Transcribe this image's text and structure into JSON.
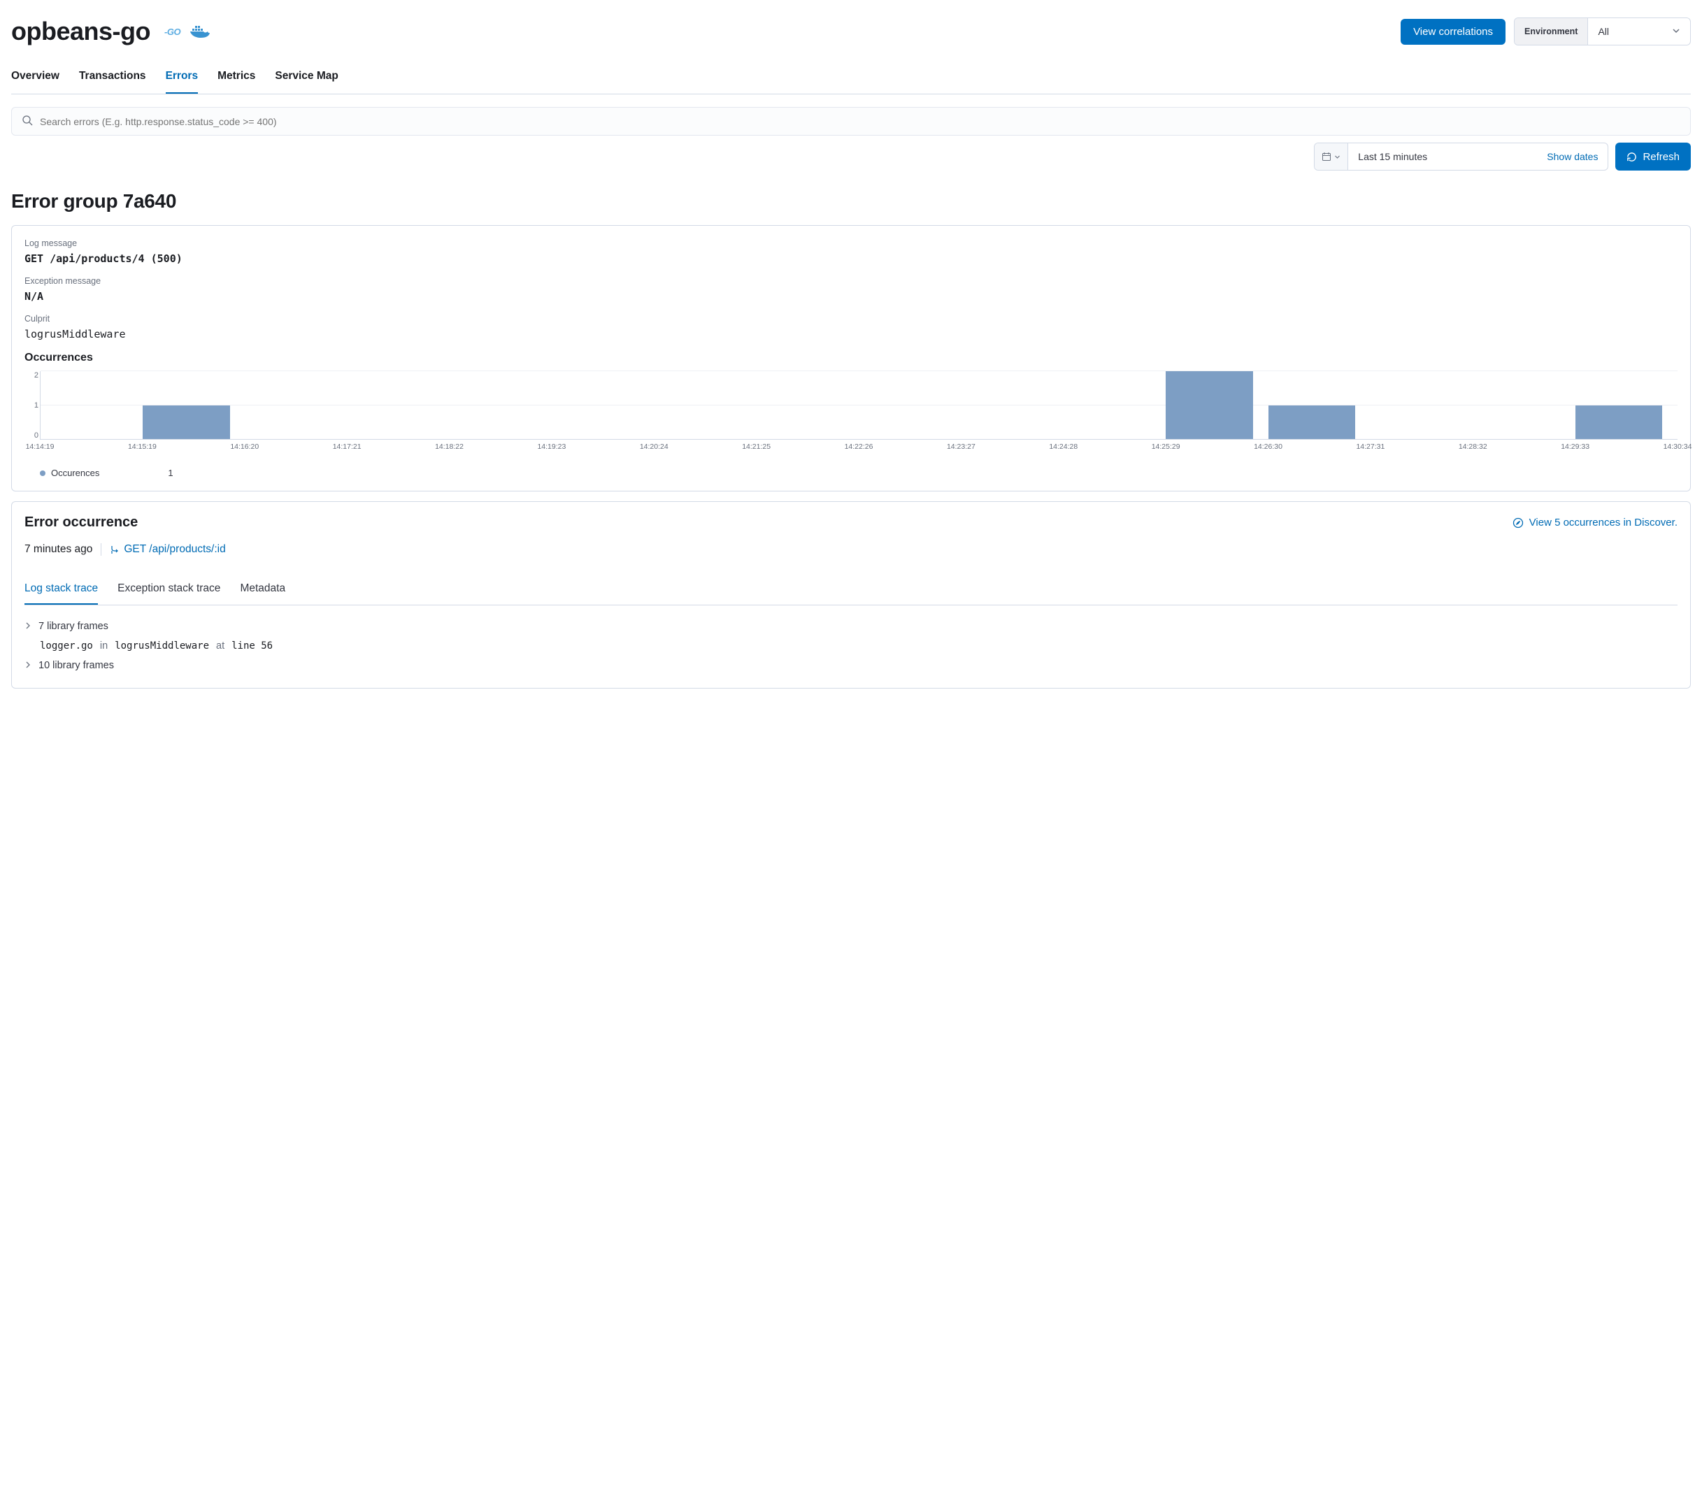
{
  "header": {
    "title": "opbeans-go",
    "go_icon_label": "-GO",
    "view_correlations_label": "View correlations",
    "environment_label": "Environment",
    "environment_value": "All"
  },
  "tabs": [
    {
      "label": "Overview",
      "active": false
    },
    {
      "label": "Transactions",
      "active": false
    },
    {
      "label": "Errors",
      "active": true
    },
    {
      "label": "Metrics",
      "active": false
    },
    {
      "label": "Service Map",
      "active": false
    }
  ],
  "search": {
    "placeholder": "Search errors (E.g. http.response.status_code >= 400)"
  },
  "datepicker": {
    "range": "Last 15 minutes",
    "show_dates_label": "Show dates",
    "refresh_label": "Refresh"
  },
  "error_group": {
    "heading": "Error group 7a640",
    "log_message_label": "Log message",
    "log_message_value": "GET /api/products/4 (500)",
    "exception_message_label": "Exception message",
    "exception_message_value": "N/A",
    "culprit_label": "Culprit",
    "culprit_value": "logrusMiddleware",
    "occurrences_title": "Occurrences"
  },
  "chart_data": {
    "type": "bar",
    "categories": [
      "14:14:19",
      "14:15:19",
      "14:16:20",
      "14:17:21",
      "14:18:22",
      "14:19:23",
      "14:20:24",
      "14:21:25",
      "14:22:26",
      "14:23:27",
      "14:24:28",
      "14:25:29",
      "14:26:30",
      "14:27:31",
      "14:28:32",
      "14:29:33",
      "14:30:34"
    ],
    "values": [
      0,
      1,
      0,
      0,
      0,
      0,
      0,
      0,
      0,
      0,
      0,
      2,
      1,
      0,
      0,
      1,
      0
    ],
    "xlabel": "",
    "ylabel": "",
    "yticks": [
      0,
      1,
      2
    ],
    "ylim": [
      0,
      2
    ],
    "legend_label": "Occurences",
    "legend_value": "1"
  },
  "occurrence": {
    "title": "Error occurrence",
    "discover_link": "View 5 occurrences in Discover.",
    "timestamp": "7 minutes ago",
    "transaction": "GET /api/products/:id",
    "subtabs": [
      {
        "label": "Log stack trace",
        "active": true
      },
      {
        "label": "Exception stack trace",
        "active": false
      },
      {
        "label": "Metadata",
        "active": false
      }
    ],
    "frames": {
      "collapsed_1": "7 library frames",
      "file": "logger.go",
      "in_word": "in",
      "func": "logrusMiddleware",
      "at_word": "at",
      "line_word": "line 56",
      "collapsed_2": "10 library frames"
    }
  }
}
